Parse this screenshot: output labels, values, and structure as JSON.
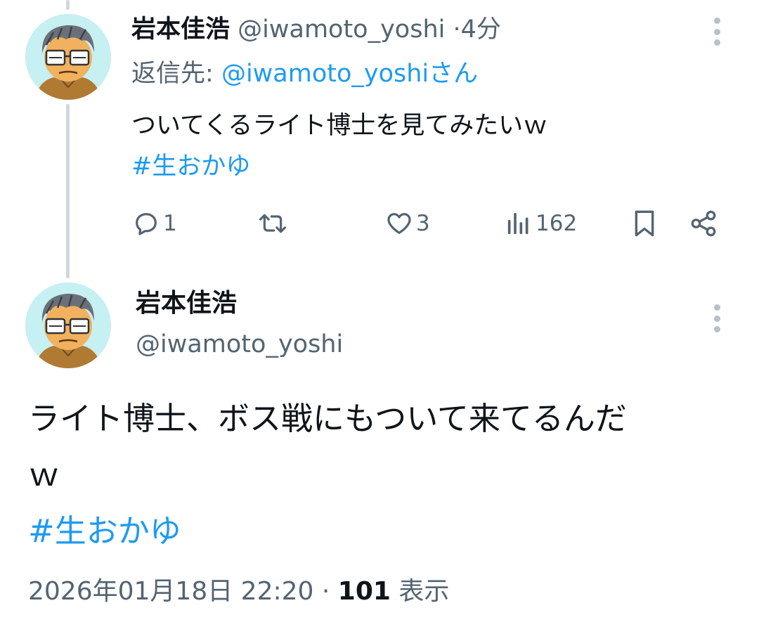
{
  "reply_tweet": {
    "display_name": "岩本佳浩",
    "handle": "@iwamoto_yoshi",
    "separator": "·",
    "time": "4分",
    "reply_to_label": "返信先:",
    "reply_to_handle": "@iwamoto_yoshi",
    "reply_to_suffix": "さん",
    "text": "ついてくるライト博士を見てみたいｗ",
    "hashtag": "#生おかゆ",
    "stats": {
      "replies": "1",
      "retweets": "",
      "likes": "3",
      "views": "162"
    }
  },
  "main_tweet": {
    "display_name": "岩本佳浩",
    "handle": "@iwamoto_yoshi",
    "text_line1": "ライト博士、ボス戦にもついて来てるんだ",
    "text_line2": "ｗ",
    "hashtag": "#生おかゆ",
    "date": "2026年01月18日 22:20",
    "separator": "·",
    "views_count": "101",
    "views_label": "表示"
  },
  "colors": {
    "link": "#1d9bf0",
    "muted": "#536471",
    "text": "#0f1419",
    "thread_line": "#cfd9de"
  },
  "icons": [
    "more-vertical-icon",
    "reply-icon",
    "retweet-icon",
    "like-icon",
    "views-icon",
    "bookmark-icon",
    "share-icon"
  ]
}
